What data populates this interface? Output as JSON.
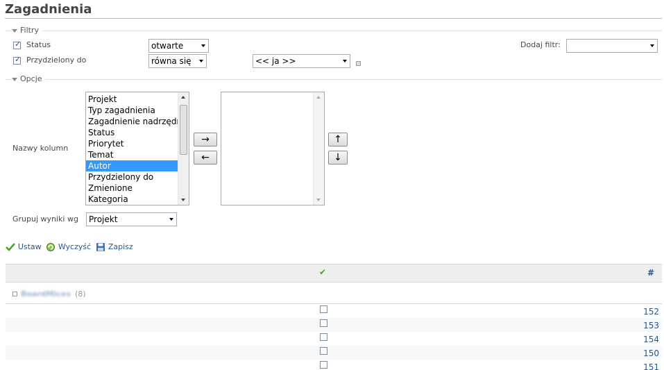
{
  "page": {
    "title": "Zagadnienia"
  },
  "filters": {
    "legend": "Filtry",
    "status": {
      "label": "Status",
      "operator": "otwarte"
    },
    "assignee": {
      "label": "Przydzielony do",
      "operator": "równa się",
      "value": "<< ja >>"
    },
    "add_filter_label": "Dodaj filtr:",
    "add_filter_value": ""
  },
  "options": {
    "legend": "Opcje",
    "columns_label": "Nazwy kolumn",
    "available_columns": [
      "Projekt",
      "Typ zagadnienia",
      "Zagadnienie nadrzędne",
      "Status",
      "Priorytet",
      "Temat",
      "Autor",
      "Przydzielony do",
      "Zmienione",
      "Kategoria"
    ],
    "selected_available": "Autor",
    "move_right_label": "→",
    "move_left_label": "←",
    "move_up_label": "↑",
    "move_down_label": "↓",
    "group_by_label": "Grupuj wyniki wg",
    "group_by_value": "Projekt"
  },
  "actions": {
    "apply": "Ustaw",
    "clear": "Wyczyść",
    "save": "Zapisz"
  },
  "results": {
    "check_header": "✔",
    "id_header": "#",
    "group": {
      "name": "BoardMices",
      "count": "(8)"
    },
    "rows": [
      {
        "id": "152"
      },
      {
        "id": "153"
      },
      {
        "id": "154"
      },
      {
        "id": "150"
      },
      {
        "id": "151"
      }
    ]
  },
  "colors": {
    "link": "#2a5685",
    "selection": "#3399ff",
    "check_green": "#4aa52e"
  }
}
